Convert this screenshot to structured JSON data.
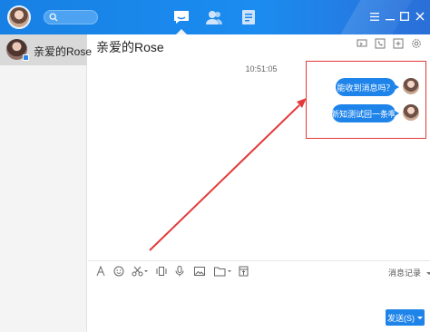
{
  "search": {
    "placeholder": ""
  },
  "nav": {
    "tabs": [
      {
        "icon": "chat-icon",
        "active": true
      },
      {
        "icon": "contacts-icon",
        "active": false
      },
      {
        "icon": "document-icon",
        "active": false
      }
    ]
  },
  "window_controls": [
    "menu-icon",
    "minimize-icon",
    "maximize-icon",
    "close-icon"
  ],
  "sidebar": {
    "contacts": [
      {
        "name": "亲爱的Rose",
        "selected": true
      }
    ]
  },
  "chat": {
    "title": "亲爱的Rose",
    "timestamp": "10:51:05",
    "messages": [
      {
        "text": "能收到消息吗？",
        "from": "me"
      },
      {
        "text": "新知测试回一条啊",
        "from": "me"
      }
    ]
  },
  "toolbar": {
    "history_label": "消息记录"
  },
  "send": {
    "label": "发送(S)"
  },
  "colors": {
    "accent": "#1f84ea",
    "highlight": "#e23a3a"
  }
}
